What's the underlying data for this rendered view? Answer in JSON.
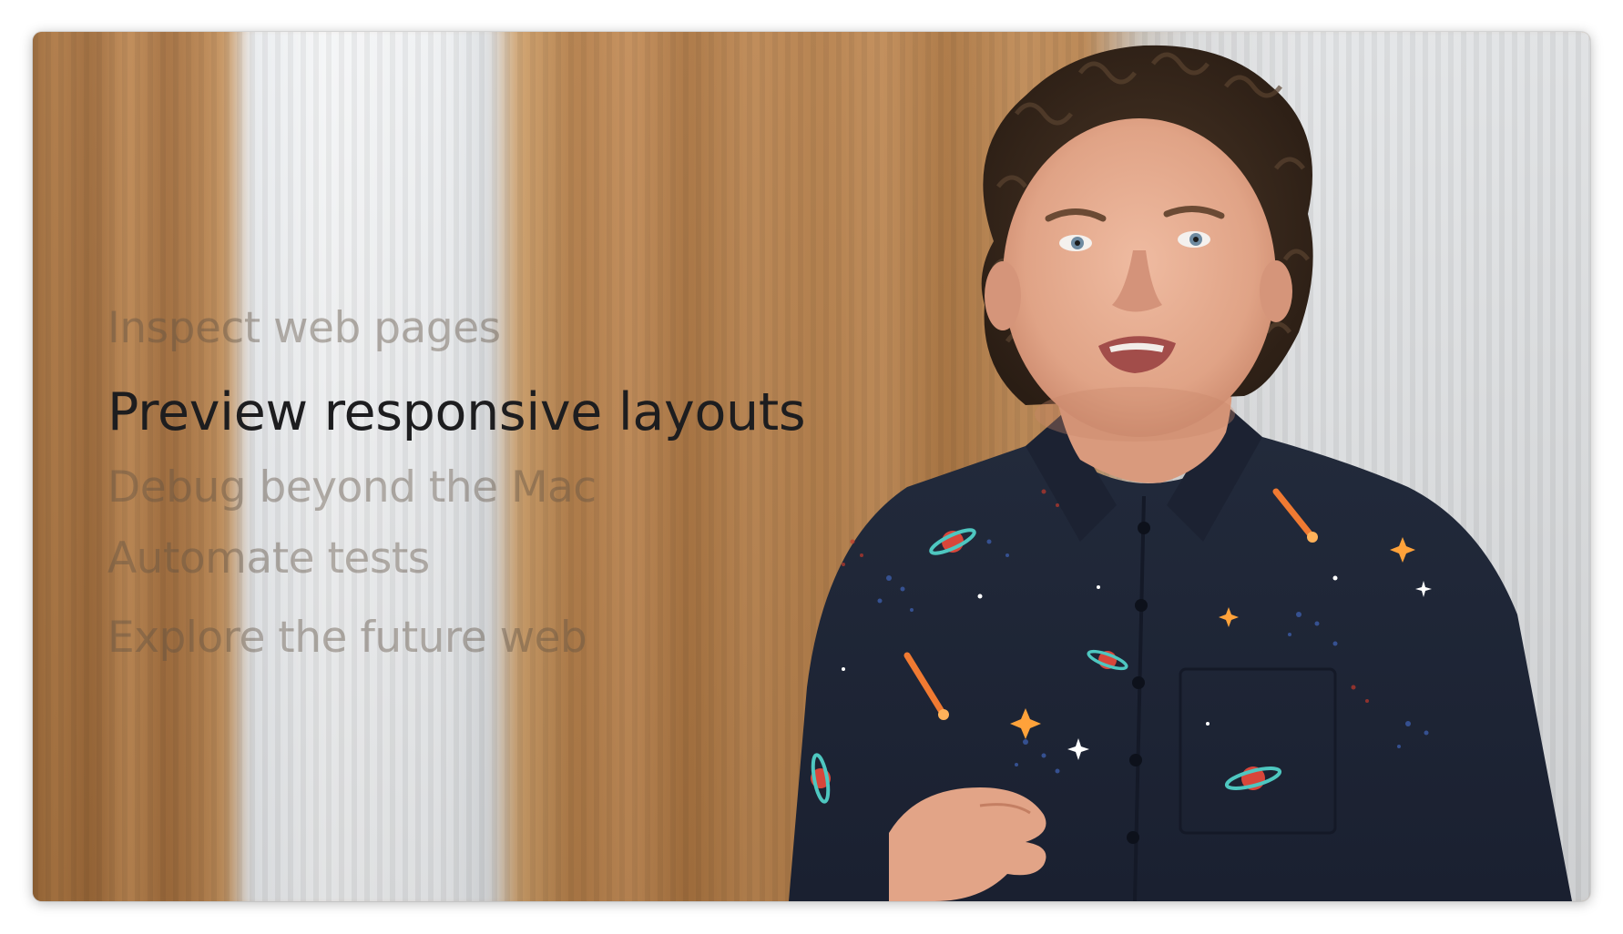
{
  "player": {
    "topics": [
      {
        "label": "Inspect web pages",
        "state": "inactive"
      },
      {
        "label": "Preview responsive layouts",
        "state": "active"
      },
      {
        "label": "Debug beyond the Mac",
        "state": "inactive"
      },
      {
        "label": "Automate tests",
        "state": "inactive"
      },
      {
        "label": "Explore the future web",
        "state": "inactive"
      }
    ]
  },
  "colors": {
    "active_text": "#1d1d1f",
    "inactive_text": "#5f5042",
    "shirt": "#1f2635",
    "hair": "#3a2a1e",
    "skin": "#e3a98f",
    "wood": "#b98756",
    "pillar": "#eef0f2"
  },
  "icons": {
    "shirt_pattern": [
      "planet-icon",
      "comet-icon",
      "star-icon"
    ]
  }
}
